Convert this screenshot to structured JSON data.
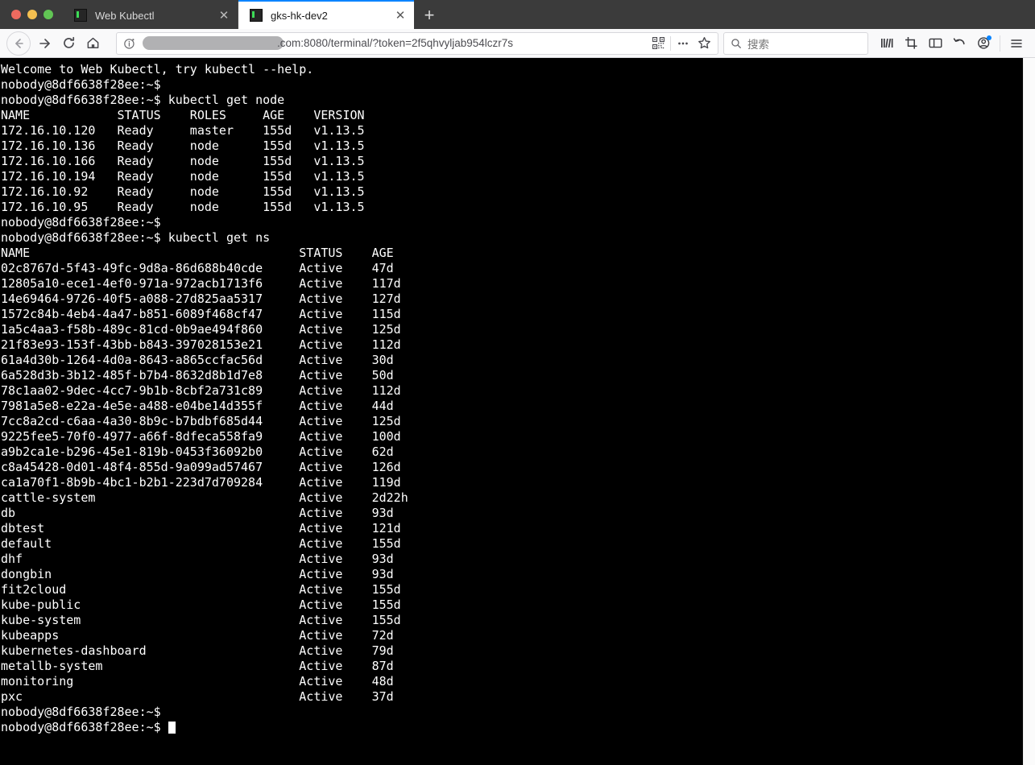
{
  "window": {
    "traffic_lights": [
      "close",
      "minimize",
      "zoom"
    ],
    "colors": {
      "close": "#ed6a5f",
      "minimize": "#f4bf50",
      "zoom": "#61c554",
      "active_tab_accent": "#0a84ff",
      "terminal_bg": "#000000",
      "terminal_fg": "#ffffff"
    }
  },
  "tabs": [
    {
      "title": "Web Kubectl",
      "active": false,
      "close_label": "✕",
      "favicon": "terminal-icon"
    },
    {
      "title": "gks-hk-dev2",
      "active": true,
      "close_label": "✕",
      "favicon": "terminal-icon"
    }
  ],
  "newtab_label": "+",
  "toolbar": {
    "back_label": "back-arrow",
    "forward_label": "forward-arrow",
    "reload_label": "reload",
    "home_label": "home",
    "url_text": ".com:8080/terminal/?token=2f5qhvyljab954lczr7s",
    "url_redacted": true,
    "qr_label": "qr-code",
    "page_actions_label": "•••",
    "bookmark_label": "star",
    "library_label": "library",
    "screenshot_label": "screenshot",
    "sidebar_label": "sidebar",
    "sync_label": "sync",
    "account_label": "account",
    "menu_label": "menu"
  },
  "search": {
    "placeholder": "搜索"
  },
  "terminal": {
    "welcome": "Welcome to Web Kubectl, try kubectl --help.",
    "prompt": "nobody@8df6638f28ee:~$",
    "commands": {
      "get_node": "kubectl get node",
      "get_ns": "kubectl get ns"
    },
    "node_table": {
      "headers": [
        "NAME",
        "STATUS",
        "ROLES",
        "AGE",
        "VERSION"
      ],
      "col_starts": [
        0,
        16,
        26,
        36,
        43
      ],
      "rows": [
        [
          "172.16.10.120",
          "Ready",
          "master",
          "155d",
          "v1.13.5"
        ],
        [
          "172.16.10.136",
          "Ready",
          "node",
          "155d",
          "v1.13.5"
        ],
        [
          "172.16.10.166",
          "Ready",
          "node",
          "155d",
          "v1.13.5"
        ],
        [
          "172.16.10.194",
          "Ready",
          "node",
          "155d",
          "v1.13.5"
        ],
        [
          "172.16.10.92",
          "Ready",
          "node",
          "155d",
          "v1.13.5"
        ],
        [
          "172.16.10.95",
          "Ready",
          "node",
          "155d",
          "v1.13.5"
        ]
      ]
    },
    "ns_table": {
      "headers": [
        "NAME",
        "STATUS",
        "AGE"
      ],
      "col_starts": [
        0,
        41,
        51
      ],
      "rows": [
        [
          "02c8767d-5f43-49fc-9d8a-86d688b40cde",
          "Active",
          "47d"
        ],
        [
          "12805a10-ece1-4ef0-971a-972acb1713f6",
          "Active",
          "117d"
        ],
        [
          "14e69464-9726-40f5-a088-27d825aa5317",
          "Active",
          "127d"
        ],
        [
          "1572c84b-4eb4-4a47-b851-6089f468cf47",
          "Active",
          "115d"
        ],
        [
          "1a5c4aa3-f58b-489c-81cd-0b9ae494f860",
          "Active",
          "125d"
        ],
        [
          "21f83e93-153f-43bb-b843-397028153e21",
          "Active",
          "112d"
        ],
        [
          "61a4d30b-1264-4d0a-8643-a865ccfac56d",
          "Active",
          "30d"
        ],
        [
          "6a528d3b-3b12-485f-b7b4-8632d8b1d7e8",
          "Active",
          "50d"
        ],
        [
          "78c1aa02-9dec-4cc7-9b1b-8cbf2a731c89",
          "Active",
          "112d"
        ],
        [
          "7981a5e8-e22a-4e5e-a488-e04be14d355f",
          "Active",
          "44d"
        ],
        [
          "7cc8a2cd-c6aa-4a30-8b9c-b7bdbf685d44",
          "Active",
          "125d"
        ],
        [
          "9225fee5-70f0-4977-a66f-8dfeca558fa9",
          "Active",
          "100d"
        ],
        [
          "a9b2ca1e-b296-45e1-819b-0453f36092b0",
          "Active",
          "62d"
        ],
        [
          "c8a45428-0d01-48f4-855d-9a099ad57467",
          "Active",
          "126d"
        ],
        [
          "ca1a70f1-8b9b-4bc1-b2b1-223d7d709284",
          "Active",
          "119d"
        ],
        [
          "cattle-system",
          "Active",
          "2d22h"
        ],
        [
          "db",
          "Active",
          "93d"
        ],
        [
          "dbtest",
          "Active",
          "121d"
        ],
        [
          "default",
          "Active",
          "155d"
        ],
        [
          "dhf",
          "Active",
          "93d"
        ],
        [
          "dongbin",
          "Active",
          "93d"
        ],
        [
          "fit2cloud",
          "Active",
          "155d"
        ],
        [
          "kube-public",
          "Active",
          "155d"
        ],
        [
          "kube-system",
          "Active",
          "155d"
        ],
        [
          "kubeapps",
          "Active",
          "72d"
        ],
        [
          "kubernetes-dashboard",
          "Active",
          "79d"
        ],
        [
          "metallb-system",
          "Active",
          "87d"
        ],
        [
          "monitoring",
          "Active",
          "48d"
        ],
        [
          "pxc",
          "Active",
          "37d"
        ]
      ]
    }
  }
}
